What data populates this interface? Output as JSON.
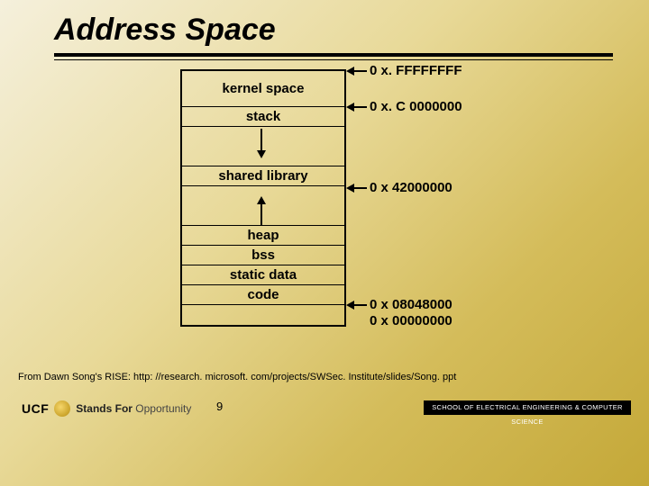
{
  "title": "Address Space",
  "memory": {
    "regions": {
      "kernel": "kernel space",
      "stack": "stack",
      "shared": "shared library",
      "heap": "heap",
      "bss": "bss",
      "static": "static data",
      "code": "code"
    },
    "addresses": {
      "top": "0 x. FFFFFFFF",
      "kernel_bottom": "0 x. C 0000000",
      "shared_bottom": "0 x 42000000",
      "code_top": "0 x 08048000",
      "bottom": "0 x 00000000"
    }
  },
  "citation": "From Dawn Song's RISE: http: //research. microsoft. com/projects/SWSec. Institute/slides/Song. ppt",
  "page_number": "9",
  "branding": {
    "ucf": "UCF",
    "tagline_bold": "Stands For",
    "tagline_rest": "Opportunity",
    "department": "SCHOOL OF ELECTRICAL ENGINEERING & COMPUTER SCIENCE"
  }
}
